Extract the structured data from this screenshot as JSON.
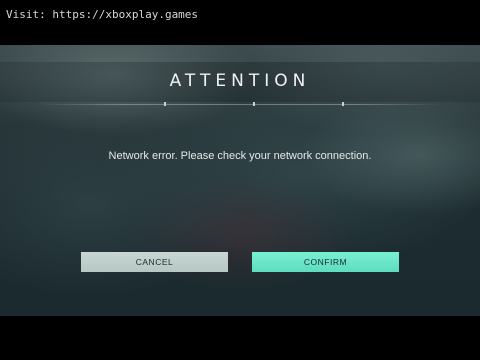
{
  "watermark": {
    "text": "Visit: https://xboxplay.games"
  },
  "dialog": {
    "title": "ATTENTION",
    "message": "Network error. Please check your network connection.",
    "cancel_label": "CANCEL",
    "confirm_label": "CONFIRM"
  },
  "colors": {
    "confirm_accent": "#68e6c8",
    "cancel_button": "#c0d0cc",
    "text_primary": "#f2f2f2"
  }
}
